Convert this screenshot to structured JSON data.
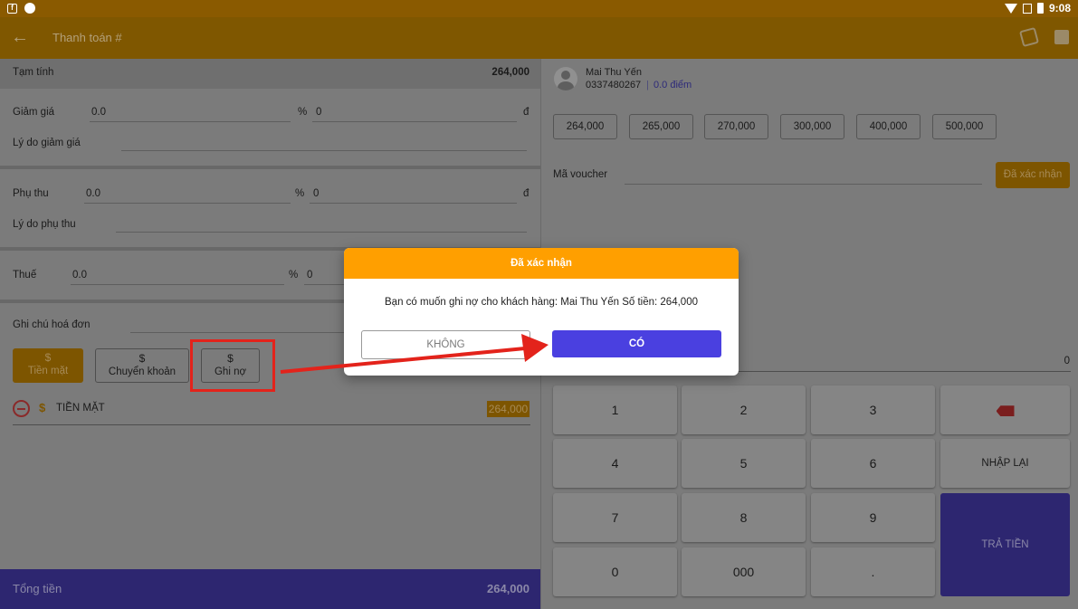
{
  "statusbar": {
    "time": "9:08"
  },
  "appbar": {
    "title": "Thanh toán #"
  },
  "left": {
    "subtotal_label": "Tạm tính",
    "subtotal_value": "264,000",
    "discount": {
      "label": "Giảm giá",
      "amount": "0.0",
      "percent_symbol": "%",
      "percent": "0",
      "currency": "đ",
      "reason_label": "Lý do giảm giá"
    },
    "surcharge": {
      "label": "Phụ thu",
      "amount": "0.0",
      "percent_symbol": "%",
      "percent": "0",
      "currency": "đ",
      "reason_label": "Lý do phụ thu"
    },
    "tax": {
      "label": "Thuế",
      "amount": "0.0",
      "percent_symbol": "%",
      "percent": "0"
    },
    "note_label": "Ghi chú hoá đơn",
    "payment_methods": [
      {
        "icon": "$",
        "label": "Tiền mặt"
      },
      {
        "icon": "$",
        "label": "Chuyển khoản"
      },
      {
        "icon": "$",
        "label": "Ghi nợ"
      }
    ],
    "cash_line": {
      "currency_icon": "$",
      "label": "TIỀN MẶT",
      "amount": "264,000"
    },
    "total_label": "Tổng tiền",
    "total_value": "264,000"
  },
  "right": {
    "customer": {
      "name": "Mai Thu Yến",
      "phone": "0337480267",
      "separator": "|",
      "points": "0.0 điểm"
    },
    "quick_amounts": [
      "264,000",
      "265,000",
      "270,000",
      "300,000",
      "400,000",
      "500,000"
    ],
    "voucher_label": "Mã voucher",
    "voucher_button": "Đã xác nhận",
    "input_value": "0",
    "keys": [
      "1",
      "2",
      "3",
      "4",
      "5",
      "6",
      "7",
      "8",
      "9",
      "0",
      "000",
      "."
    ],
    "reset_label": "NHẬP LẠI",
    "pay_label": "TRẢ TIỀN"
  },
  "modal": {
    "title": "Đã xác nhận",
    "message": "Bạn có muốn ghi nợ cho khách hàng: Mai Thu Yến Số tiền: 264,000",
    "no_label": "KHÔNG",
    "yes_label": "CÓ"
  },
  "colors": {
    "accent": "#ff9f00",
    "primary": "#4a40e0",
    "annotation": "#e3231b"
  }
}
